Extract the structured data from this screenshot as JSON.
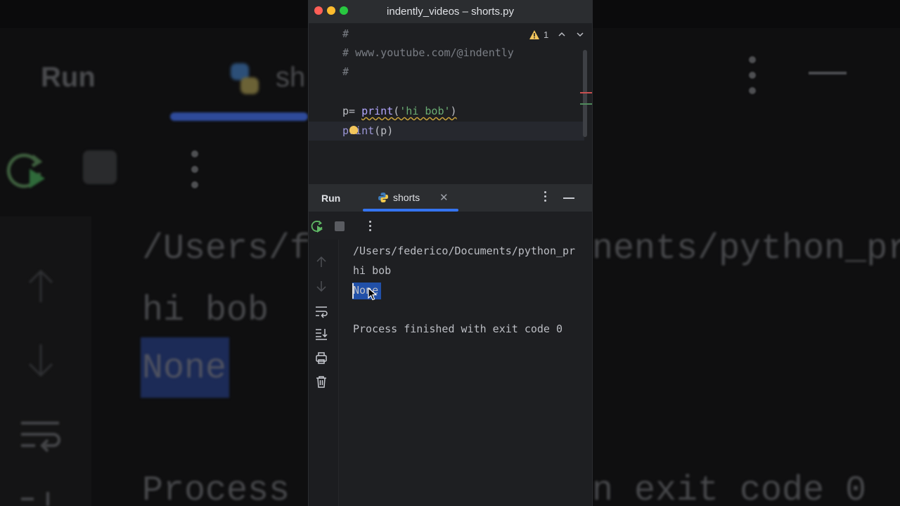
{
  "window": {
    "title": "indently_videos – shorts.py"
  },
  "editor": {
    "lines": [
      {
        "text": "#"
      },
      {
        "text": "# www.youtube.com/@indently"
      },
      {
        "text": "#"
      },
      {
        "text": ""
      },
      {
        "var": "p",
        "op": "= ",
        "fn": "print",
        "open": "(",
        "str": "'hi bob'",
        "close": ")"
      },
      {
        "fn": "print",
        "args": "(p)"
      }
    ],
    "warning_count": "1"
  },
  "run_panel": {
    "title": "Run",
    "tab_label": "shorts",
    "close_glyph": "✕"
  },
  "console": {
    "lines": [
      "/Users/federico/Documents/python_pr",
      "hi bob",
      "None",
      "",
      "Process finished with exit code 0"
    ]
  },
  "background": {
    "run_label": "Run",
    "tab_partial": "sh",
    "path_partial": "/Users/f",
    "path_partial_right": "nents/python_pr",
    "output_hi": "hi bob",
    "output_none": "None",
    "process_left": "Process",
    "process_right": "n exit code 0"
  },
  "colors": {
    "accent": "#3574f0",
    "selection": "#2150a8",
    "string": "#6aab73",
    "function": "#b3a8ff",
    "comment": "#7a7e85"
  }
}
